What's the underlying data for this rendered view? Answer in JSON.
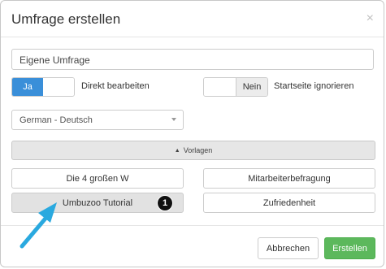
{
  "dialog": {
    "title": "Umfrage erstellen",
    "close_label": "×"
  },
  "survey_name": {
    "value": "Eigene Umfrage",
    "placeholder": "Eigene Umfrage"
  },
  "direct_edit": {
    "toggle_label": "Ja",
    "label": "Direkt bearbeiten"
  },
  "ignore_start": {
    "toggle_label": "Nein",
    "label": "Startseite ignorieren"
  },
  "language": {
    "selected": "German - Deutsch"
  },
  "templates": {
    "label": "Vorlagen",
    "items": [
      "Die 4 großen W",
      "Mitarbeiterbefragung",
      "Umbuzoo Tutorial",
      "Zufriedenheit"
    ]
  },
  "annotation": {
    "badge": "1",
    "colors": {
      "arrow": "#2aa9df",
      "badge": "#111111"
    }
  },
  "footer": {
    "cancel_label": "Abbrechen",
    "create_label": "Erstellen"
  },
  "colors": {
    "toggle_on": "#3a8fd9",
    "create_button": "#5cb85c"
  }
}
